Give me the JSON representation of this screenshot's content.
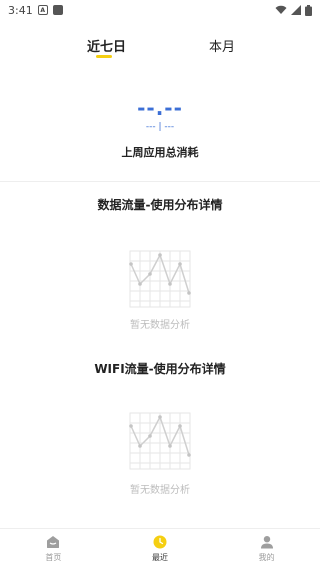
{
  "status_bar": {
    "time": "3:41",
    "notification_icon": "A"
  },
  "tabs": {
    "week": "近七日",
    "month": "本月"
  },
  "summary": {
    "value": "--.--",
    "sub_left": "---",
    "sub_right": "---",
    "label": "上周应用总消耗"
  },
  "sections": [
    {
      "title": "数据流量-使用分布详情",
      "empty_text": "暂无数据分析"
    },
    {
      "title": "WIFI流量-使用分布详情",
      "empty_text": "暂无数据分析"
    }
  ],
  "nav": {
    "items": [
      {
        "label": "首页",
        "icon": "home-icon"
      },
      {
        "label": "最近",
        "icon": "clock-icon"
      },
      {
        "label": "我的",
        "icon": "user-icon"
      }
    ]
  },
  "colors": {
    "accent": "#f5cf12",
    "value_blue": "#3c6fd6",
    "placeholder_gray": "#bdbdbd"
  }
}
